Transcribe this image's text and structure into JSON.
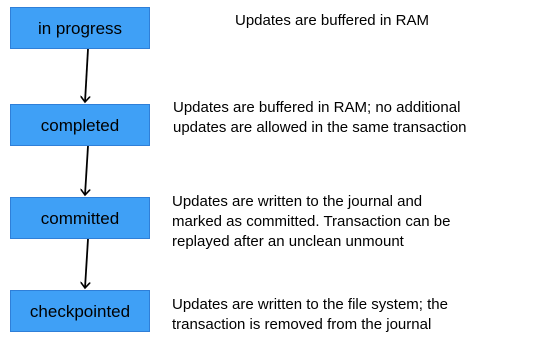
{
  "colors": {
    "box_fill": "#3fa0f6",
    "box_border": "#2f7fd8",
    "text": "#000000",
    "arrow": "#000000"
  },
  "states": [
    {
      "label": "in progress",
      "description": [
        "Updates are buffered in RAM"
      ]
    },
    {
      "label": "completed",
      "description": [
        "Updates are buffered in RAM; no additional",
        "updates are allowed in the same transaction"
      ]
    },
    {
      "label": "committed",
      "description": [
        "Updates are written to the journal and",
        "marked as committed. Transaction can be",
        "replayed after an unclean unmount"
      ]
    },
    {
      "label": "checkpointed",
      "description": [
        "Updates are written to the file system; the",
        "transaction is removed from the journal"
      ]
    }
  ]
}
